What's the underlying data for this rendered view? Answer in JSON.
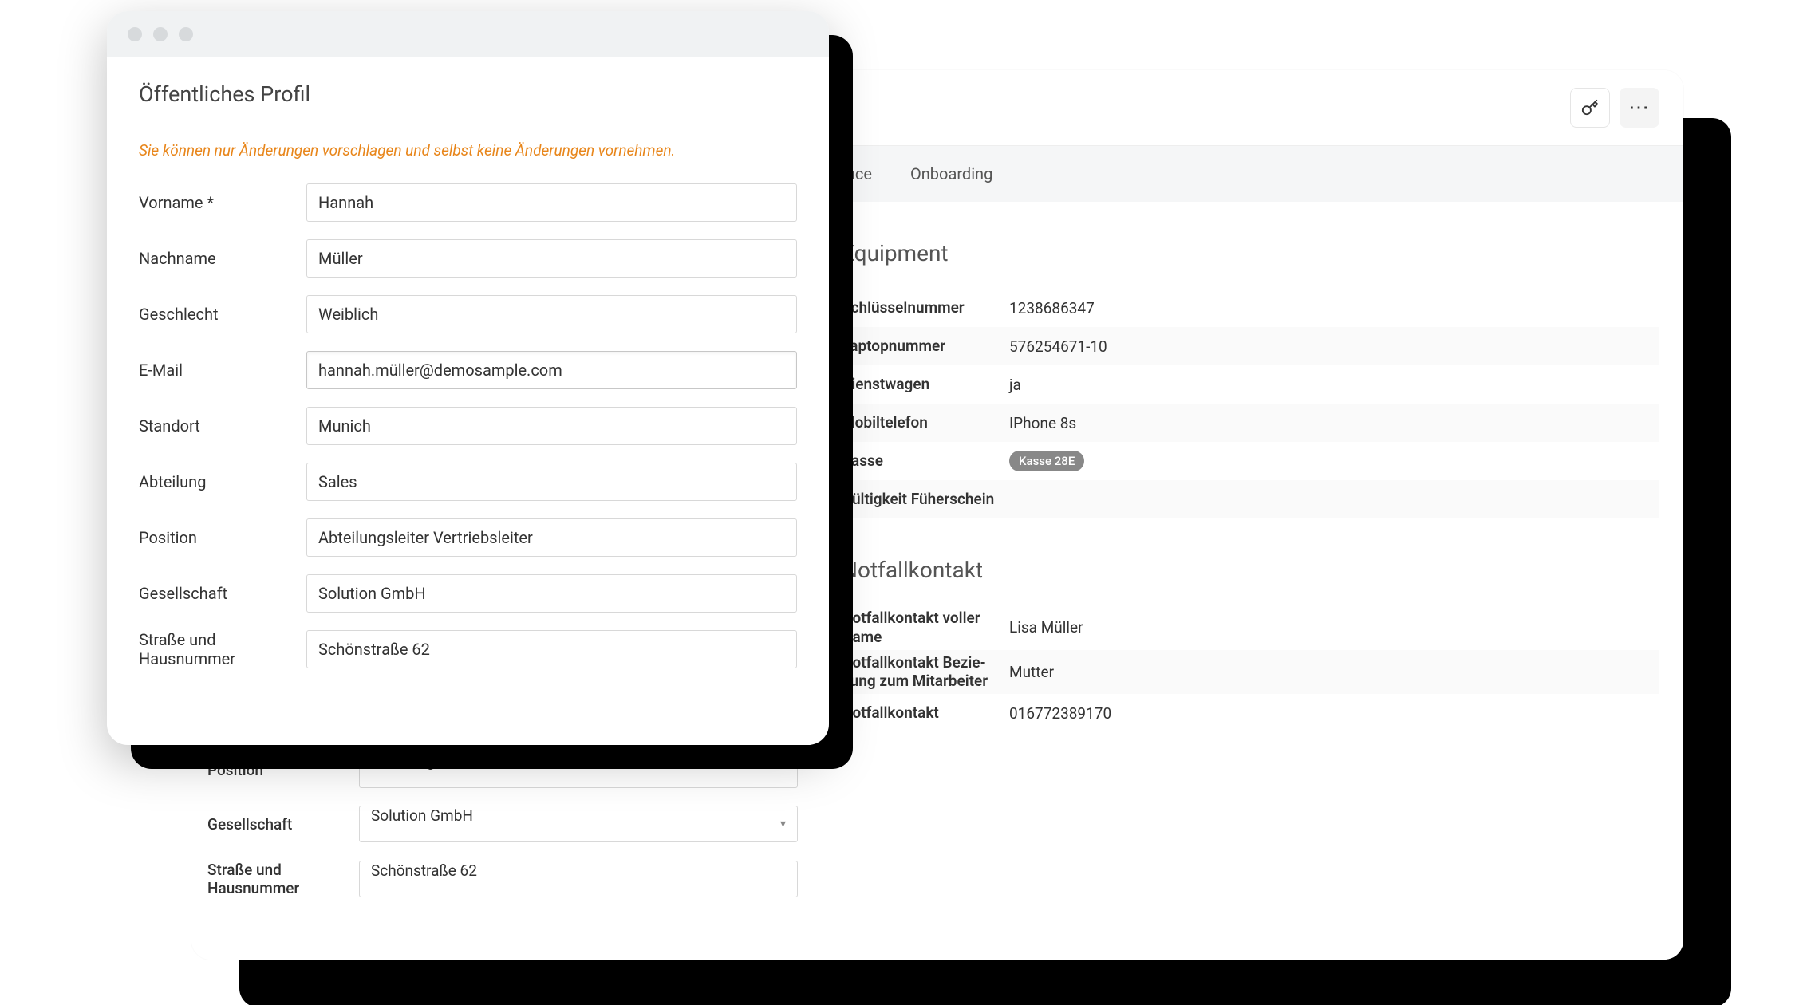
{
  "back": {
    "tabs": [
      "ance",
      "Onboarding"
    ],
    "form": {
      "position_label": "Position",
      "position_value": "Abteilungsleiter Vertriebsleiter",
      "company_label": "Gesellschaft",
      "company_value": "Solution GmbH",
      "street_label": "Straße und Hausnummer",
      "street_value": "Schönstraße 62"
    },
    "equipment": {
      "title": "Equipment",
      "rows": [
        {
          "k": "Schlüsselnummer",
          "v": "1238686347"
        },
        {
          "k": "Laptopnummer",
          "v": "576254671-10"
        },
        {
          "k": "Dienstwagen",
          "v": "ja"
        },
        {
          "k": "Mobiltelefon",
          "v": "IPhone 8s"
        },
        {
          "k": "Kasse",
          "chip": "Kasse 28E"
        },
        {
          "k": "Gültigkeit Füherschein",
          "v": ""
        }
      ]
    },
    "emergency": {
      "title": "Notfallkontakt",
      "rows": [
        {
          "k": "Notfallkontakt voller Name",
          "v": "Lisa Müller"
        },
        {
          "k": "Notfallkontakt Bezie­hung zum Mitarbeiter",
          "v": "Mutter"
        },
        {
          "k": "Notfallkontakt",
          "v": "016772389170"
        }
      ]
    }
  },
  "modal": {
    "heading": "Öffentliches Profil",
    "notice": "Sie können nur Änderungen vorschlagen und selbst keine Änderungen vornehmen.",
    "fields": {
      "vorname_l": "Vorname *",
      "vorname_v": "Hannah",
      "nachname_l": "Nachname",
      "nachname_v": "Müller",
      "geschlecht_l": "Geschlecht",
      "geschlecht_v": "Weiblich",
      "email_l": "E-Mail",
      "email_v": "hannah.müller@demosample.com",
      "standort_l": "Standort",
      "standort_v": "Munich",
      "abteilung_l": "Abteilung",
      "abteilung_v": "Sales",
      "position_l": "Position",
      "position_v": "Abteilungsleiter Vertriebsleiter",
      "gesellschaft_l": "Gesellschaft",
      "gesellschaft_v": "Solution GmbH",
      "strasse_l": "Straße und Hausnummer",
      "strasse_v": "Schönstraße 62"
    }
  }
}
